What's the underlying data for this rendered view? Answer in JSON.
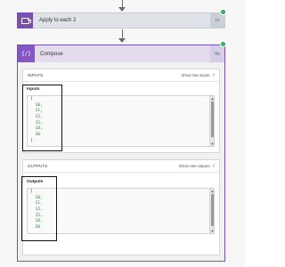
{
  "apply_each": {
    "title": "Apply to each 2",
    "duration": "1s"
  },
  "compose": {
    "icon_text": "{/}",
    "title": "Compose",
    "duration": "0s"
  },
  "inputs_section": {
    "label": "INPUTS",
    "link": "Show raw inputs",
    "field_title": "Inputs",
    "lines": [
      "[",
      "  10,",
      "  11,",
      "  12,",
      "  15,",
      "  18,",
      "  20",
      "]"
    ]
  },
  "outputs_section": {
    "label": "OUTPUTS",
    "link": "Show raw outputs",
    "field_title": "Outputs",
    "lines": [
      "[",
      "  10,",
      "  11,",
      "  12,",
      "  15,",
      "  18,",
      "  20"
    ]
  },
  "colors": {
    "accent": "#7a4fb3",
    "success": "#21a453",
    "link": "#2b79d6",
    "json_value": "#2d7a32"
  },
  "icons": {
    "apply_each": "loop-icon",
    "compose": "braces-icon",
    "status": "check-icon",
    "expand": "chevron-right-icon"
  }
}
